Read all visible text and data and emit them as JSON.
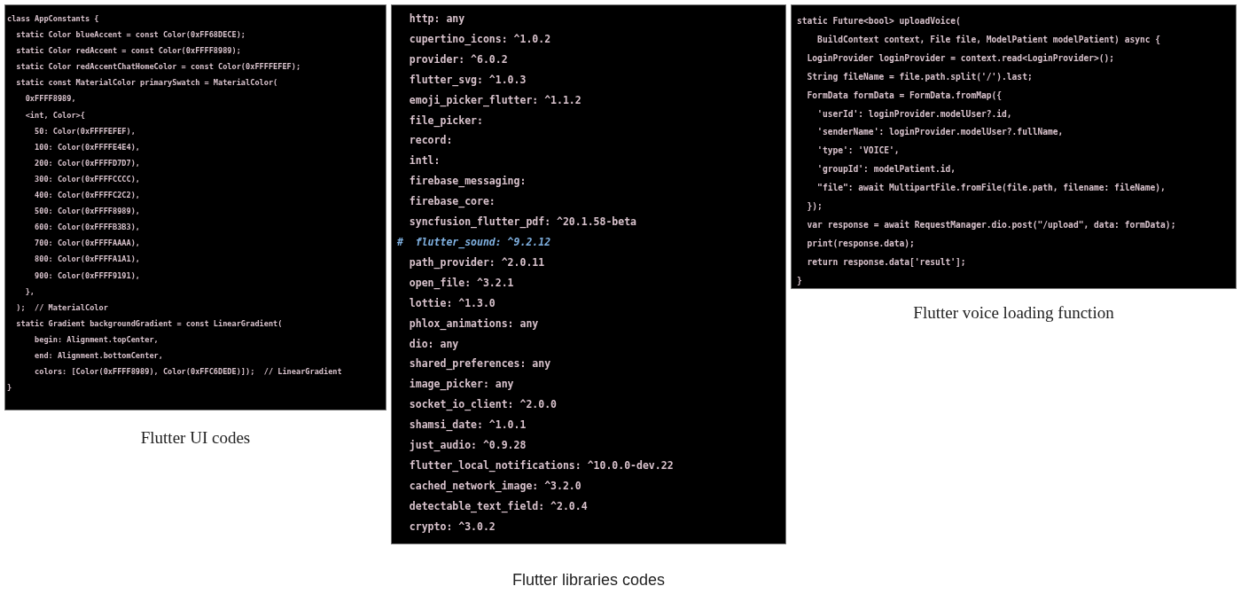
{
  "figures": [
    {
      "caption": "Flutter UI codes",
      "lines": [
        {
          "kind": "code",
          "text": "class AppConstants {"
        },
        {
          "kind": "code",
          "text": "  static Color blueAccent = const Color(0xFF68DECE);"
        },
        {
          "kind": "code",
          "text": "  static Color redAccent = const Color(0xFFFF8989);"
        },
        {
          "kind": "code",
          "text": "  static Color redAccentChatHomeColor = const Color(0xFFFFEFEF);"
        },
        {
          "kind": "code",
          "text": "  static const MaterialColor primarySwatch = MaterialColor("
        },
        {
          "kind": "code",
          "text": "    0xFFFF8989,"
        },
        {
          "kind": "code",
          "text": "    <int, Color>{"
        },
        {
          "kind": "code",
          "text": "      50: Color(0xFFFFEFEF),"
        },
        {
          "kind": "code",
          "text": "      100: Color(0xFFFFE4E4),"
        },
        {
          "kind": "code",
          "text": "      200: Color(0xFFFFD7D7),"
        },
        {
          "kind": "code",
          "text": "      300: Color(0xFFFFCCCC),"
        },
        {
          "kind": "code",
          "text": "      400: Color(0xFFFFC2C2),"
        },
        {
          "kind": "code",
          "text": "      500: Color(0xFFFF8989),"
        },
        {
          "kind": "code",
          "text": "      600: Color(0xFFFFB3B3),"
        },
        {
          "kind": "code",
          "text": "      700: Color(0xFFFFAAAA),"
        },
        {
          "kind": "code",
          "text": "      800: Color(0xFFFFA1A1),"
        },
        {
          "kind": "code",
          "text": "      900: Color(0xFFFF9191),"
        },
        {
          "kind": "code",
          "text": "    },"
        },
        {
          "kind": "code",
          "text": "  );  // MaterialColor"
        },
        {
          "kind": "code",
          "text": "  static Gradient backgroundGradient = const LinearGradient("
        },
        {
          "kind": "code",
          "text": "      begin: Alignment.topCenter,"
        },
        {
          "kind": "code",
          "text": "      end: Alignment.bottomCenter,"
        },
        {
          "kind": "code",
          "text": "      colors: [Color(0xFFFF8989), Color(0xFFC6DEDE)]);  // LinearGradient"
        },
        {
          "kind": "code",
          "text": "}"
        }
      ]
    },
    {
      "caption": "Flutter libraries codes",
      "lines": [
        {
          "kind": "code",
          "text": "  http: any"
        },
        {
          "kind": "code",
          "text": "  cupertino_icons: ^1.0.2"
        },
        {
          "kind": "code",
          "text": "  provider: ^6.0.2"
        },
        {
          "kind": "code",
          "text": "  flutter_svg: ^1.0.3"
        },
        {
          "kind": "code",
          "text": "  emoji_picker_flutter: ^1.1.2"
        },
        {
          "kind": "code",
          "text": "  file_picker:"
        },
        {
          "kind": "code",
          "text": "  record:"
        },
        {
          "kind": "code",
          "text": "  intl:"
        },
        {
          "kind": "code",
          "text": "  firebase_messaging:"
        },
        {
          "kind": "code",
          "text": "  firebase_core:"
        },
        {
          "kind": "code",
          "text": "  syncfusion_flutter_pdf: ^20.1.58-beta"
        },
        {
          "kind": "comment",
          "text": "#  flutter_sound: ^9.2.12"
        },
        {
          "kind": "code",
          "text": "  path_provider: ^2.0.11"
        },
        {
          "kind": "code",
          "text": "  open_file: ^3.2.1"
        },
        {
          "kind": "code",
          "text": "  lottie: ^1.3.0"
        },
        {
          "kind": "code",
          "text": "  phlox_animations: any"
        },
        {
          "kind": "code",
          "text": "  dio: any"
        },
        {
          "kind": "code",
          "text": "  shared_preferences: any"
        },
        {
          "kind": "code",
          "text": "  image_picker: any"
        },
        {
          "kind": "code",
          "text": "  socket_io_client: ^2.0.0"
        },
        {
          "kind": "code",
          "text": "  shamsi_date: ^1.0.1"
        },
        {
          "kind": "code",
          "text": "  just_audio: ^0.9.28"
        },
        {
          "kind": "code",
          "text": "  flutter_local_notifications: ^10.0.0-dev.22"
        },
        {
          "kind": "code",
          "text": "  cached_network_image: ^3.2.0"
        },
        {
          "kind": "code",
          "text": "  detectable_text_field: ^2.0.4"
        },
        {
          "kind": "code",
          "text": "  crypto: ^3.0.2"
        }
      ]
    },
    {
      "caption": "Flutter voice loading function",
      "lines": [
        {
          "kind": "code",
          "text": "static Future<bool> uploadVoice("
        },
        {
          "kind": "code",
          "text": "    BuildContext context, File file, ModelPatient modelPatient) async {"
        },
        {
          "kind": "code",
          "text": "  LoginProvider loginProvider = context.read<LoginProvider>();"
        },
        {
          "kind": "code",
          "text": "  String fileName = file.path.split('/').last;"
        },
        {
          "kind": "code",
          "text": "  FormData formData = FormData.fromMap({"
        },
        {
          "kind": "code",
          "text": "    'userId': loginProvider.modelUser?.id,"
        },
        {
          "kind": "code",
          "text": "    'senderName': loginProvider.modelUser?.fullName,"
        },
        {
          "kind": "code",
          "text": "    'type': 'VOICE',"
        },
        {
          "kind": "code",
          "text": "    'groupId': modelPatient.id,"
        },
        {
          "kind": "code",
          "text": "    \"file\": await MultipartFile.fromFile(file.path, filename: fileName),"
        },
        {
          "kind": "code",
          "text": "  });"
        },
        {
          "kind": "code",
          "text": "  var response = await RequestManager.dio.post(\"/upload\", data: formData);"
        },
        {
          "kind": "code",
          "text": "  print(response.data);"
        },
        {
          "kind": "code",
          "text": "  return response.data['result'];"
        },
        {
          "kind": "code",
          "text": "}"
        }
      ]
    }
  ]
}
